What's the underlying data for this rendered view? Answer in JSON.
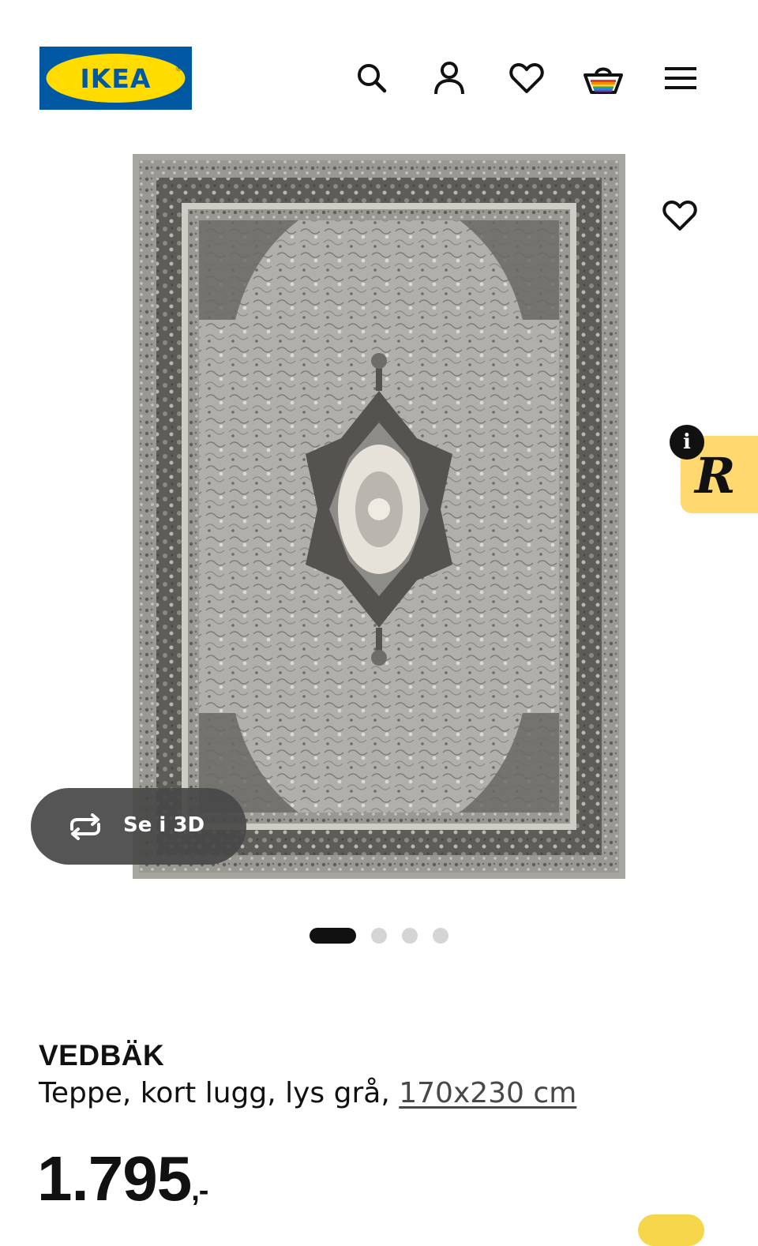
{
  "header": {
    "logo_text": "IKEA",
    "logo_colors": {
      "blue": "#0058a3",
      "yellow": "#ffdb00"
    },
    "icons": [
      "search-icon",
      "profile-icon",
      "heart-icon",
      "basket-icon",
      "menu-icon"
    ]
  },
  "hero": {
    "image_description_icon": "rug-image",
    "favorite_icon": "heart-icon",
    "view_3d_label": "Se i 3D",
    "view_3d_icon": "rotate-icon",
    "carousel": {
      "total": 4,
      "active": 1
    }
  },
  "promo_badge": {
    "letter": "R",
    "info_label": "i",
    "color": "#ffd970"
  },
  "product": {
    "name": "VEDBÄK",
    "description": "Teppe, kort lugg, lys grå, ",
    "size": "170x230 cm",
    "price": "1.795",
    "price_suffix": ",-"
  }
}
